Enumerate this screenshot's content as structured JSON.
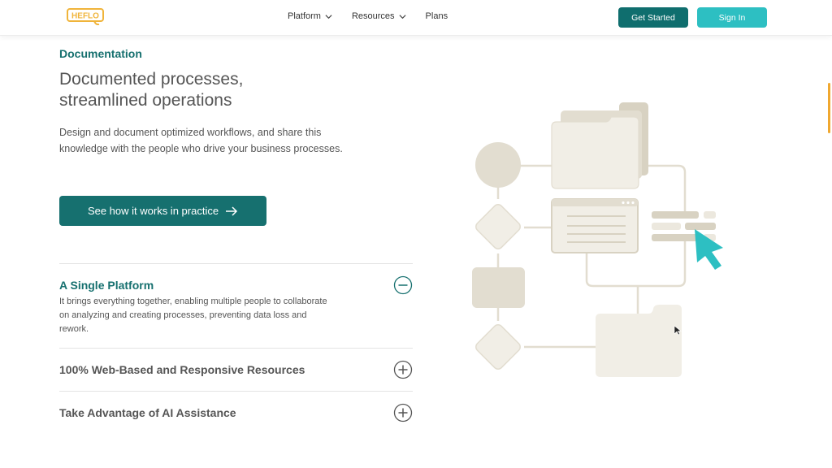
{
  "header": {
    "logo_text": "HEFLO",
    "nav": [
      {
        "label": "Platform",
        "has_dropdown": true
      },
      {
        "label": "Resources",
        "has_dropdown": true
      },
      {
        "label": "Plans",
        "has_dropdown": false
      }
    ],
    "get_started_label": "Get Started",
    "sign_in_label": "Sign In"
  },
  "hero": {
    "eyebrow": "Documentation",
    "headline_line1": "Documented processes,",
    "headline_line2": "streamlined operations",
    "description": "Design and document optimized workflows, and share this knowledge with the people who drive your business processes.",
    "cta_label": "See how it works in practice"
  },
  "accordion": [
    {
      "title": "A Single Platform",
      "expanded": true,
      "body": "It brings everything together, enabling multiple people to collaborate on analyzing and creating processes, preventing data loss and rework."
    },
    {
      "title": "100% Web-Based and Responsive Resources",
      "expanded": false
    },
    {
      "title": "Take Advantage of AI Assistance",
      "expanded": false
    }
  ],
  "colors": {
    "brand_teal": "#16706f",
    "accent_cyan": "#2dbfc2",
    "logo_yellow": "#f0b43a",
    "illustration_beige": "#e2ddd0"
  },
  "icons": [
    "chevron-down-icon",
    "arrow-right-icon",
    "minus-circle-icon",
    "plus-circle-icon",
    "cursor-icon"
  ]
}
